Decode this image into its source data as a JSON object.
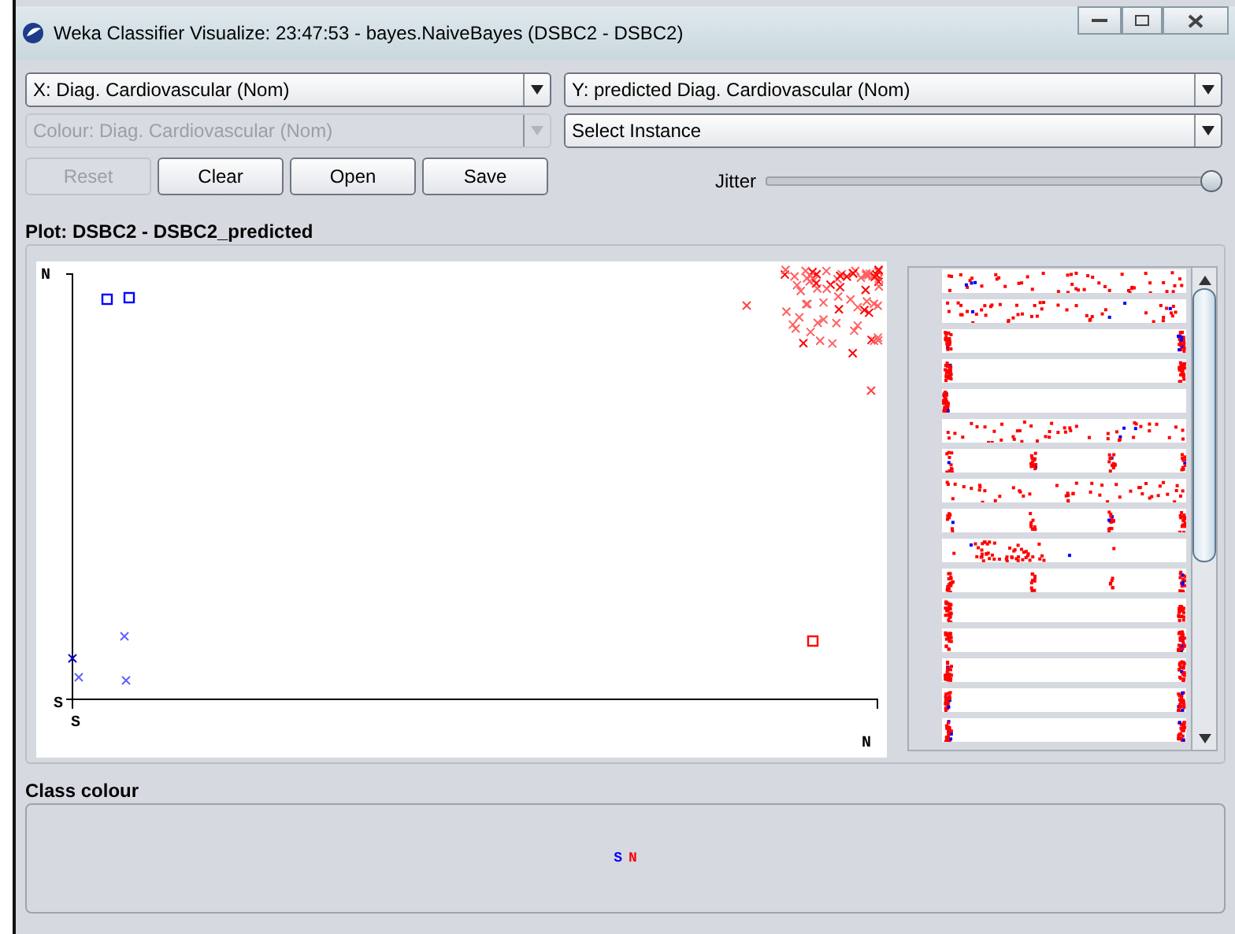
{
  "window": {
    "title": "Weka Classifier Visualize: 23:47:53 - bayes.NaiveBayes (DSBC2 - DSBC2)"
  },
  "selectors": [
    {
      "label": "X: Diag. Cardiovascular (Nom)",
      "disabled": false
    },
    {
      "label": "Y: predicted Diag. Cardiovascular (Nom)",
      "disabled": false
    },
    {
      "label": "Colour: Diag. Cardiovascular (Nom)",
      "disabled": true
    },
    {
      "label": "Select Instance",
      "disabled": false
    }
  ],
  "buttons": [
    {
      "label": "Reset",
      "disabled": true
    },
    {
      "label": "Clear",
      "disabled": false
    },
    {
      "label": "Open",
      "disabled": false
    },
    {
      "label": "Save",
      "disabled": false
    }
  ],
  "jitter": {
    "label": "Jitter",
    "level": 1
  },
  "plot": {
    "title": "Plot: DSBC2 - DSBC2_predicted",
    "y_labels": [
      "N",
      "S"
    ],
    "x_labels": [
      "S",
      "N"
    ]
  },
  "class_colour": {
    "title": "Class colour",
    "classes": [
      {
        "label": "S",
        "color": "#0000ff"
      },
      {
        "label": "N",
        "color": "#ff0000"
      }
    ]
  }
}
